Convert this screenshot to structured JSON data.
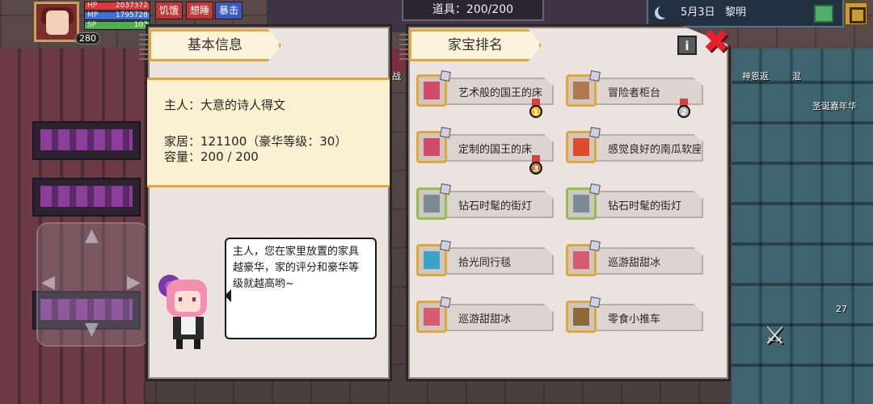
{
  "hud": {
    "hp_label": "HP",
    "hp_value": "2037372",
    "mp_label": "MP",
    "mp_value": "1795728",
    "sp_label": "SP",
    "sp_value": "107",
    "level": "280",
    "hunger": "饥饿",
    "sleepy": "想睡",
    "drunk": "暴击",
    "items_label": "道具：200/200",
    "date": "5月3日",
    "time_of_day": "黎明",
    "side_right_1": "神恩返",
    "side_right_2": "混",
    "side_right_3": "圣诞嘉年华",
    "side_left_1": "战",
    "counter_27": "27"
  },
  "basic_info": {
    "tab_title": "基本信息",
    "owner": "主人：大意的诗人得文",
    "housing": "家居：121100（豪华等级：30）",
    "capacity": "容量：200 / 200",
    "tip": "主人，您在家里放置的家具越豪华，家的评分和豪华等级就越高哟~"
  },
  "ranking": {
    "tab_title": "家宝排名",
    "info_btn": "i",
    "close_btn": "✖",
    "items": [
      {
        "label": "艺术般的国王的床",
        "medal": "1"
      },
      {
        "label": "冒险者柜台",
        "medal": "2"
      },
      {
        "label": "定制的国王的床",
        "medal": "3"
      },
      {
        "label": "感觉良好的南瓜软座",
        "medal": ""
      },
      {
        "label": "钻石时髦的街灯",
        "medal": ""
      },
      {
        "label": "钻石时髦的街灯",
        "medal": ""
      },
      {
        "label": "拾光同行毯",
        "medal": ""
      },
      {
        "label": "巡游甜甜冰",
        "medal": ""
      },
      {
        "label": "巡游甜甜冰",
        "medal": ""
      },
      {
        "label": "零食小推车",
        "medal": ""
      }
    ]
  },
  "colors": {
    "accent": "#e3a63a",
    "hp": "#e0353a",
    "mp": "#3f6fd6",
    "sp": "#4fb04f",
    "gold_medal": "#f0b820",
    "silver_medal": "#b8b8c4",
    "bronze_medal": "#c77a2e"
  }
}
